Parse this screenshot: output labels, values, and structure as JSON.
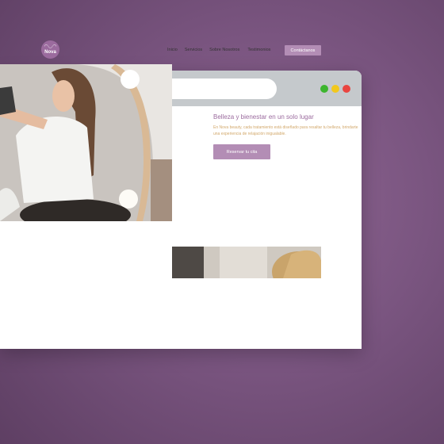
{
  "browser": {
    "search_placeholder": "",
    "dots": [
      {
        "name": "green-dot",
        "color": "#3db52e"
      },
      {
        "name": "yellow-dot",
        "color": "#f2c81d"
      },
      {
        "name": "red-dot",
        "color": "#e94540"
      }
    ]
  },
  "site": {
    "logo": {
      "crest": "◠◡◠",
      "name": "Nova"
    },
    "nav": {
      "items": [
        "Inicio",
        "Servicios",
        "Sobre Nosotros",
        "Testimonios"
      ],
      "cta": "Contáctanos"
    },
    "hero": {
      "title": "Belleza y bienestar en un solo lugar",
      "text": "En Nova beauty, cada tratamiento está diseñado para resaltar tu belleza, brindarte una experiencia de relajación inigualable.",
      "button": "Reservar tu cita"
    }
  }
}
